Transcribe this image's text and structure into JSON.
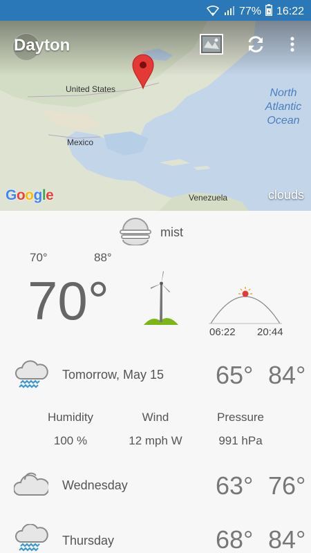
{
  "status_bar": {
    "battery": "77%",
    "time": "16:22"
  },
  "header": {
    "city": "Dayton"
  },
  "map": {
    "labels": {
      "us": "United States",
      "mexico": "Mexico",
      "venezuela": "Venezuela",
      "ocean": "North Atlantic Ocean"
    },
    "attribution": "Google",
    "layer": "clouds"
  },
  "current": {
    "condition": "mist",
    "low": "70°",
    "high": "88°",
    "temp": "70°",
    "sunrise": "06:22",
    "sunset": "20:44"
  },
  "forecast": [
    {
      "day": "Tomorrow, May 15",
      "low": "65°",
      "high": "84°",
      "icon": "rain-cloud-icon"
    },
    {
      "day": "Wednesday",
      "low": "63°",
      "high": "76°",
      "icon": "cloudy-icon"
    },
    {
      "day": "Thursday",
      "low": "68°",
      "high": "84°",
      "icon": "rain-cloud-icon"
    }
  ],
  "details": {
    "humidity_label": "Humidity",
    "humidity": "100 %",
    "wind_label": "Wind",
    "wind": "12 mph W",
    "pressure_label": "Pressure",
    "pressure": "991 hPa"
  }
}
